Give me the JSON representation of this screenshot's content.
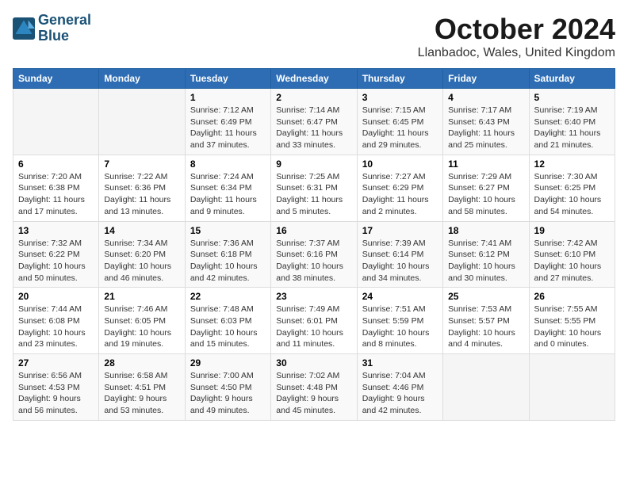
{
  "header": {
    "logo_line1": "General",
    "logo_line2": "Blue",
    "title": "October 2024",
    "location": "Llanbadoc, Wales, United Kingdom"
  },
  "weekdays": [
    "Sunday",
    "Monday",
    "Tuesday",
    "Wednesday",
    "Thursday",
    "Friday",
    "Saturday"
  ],
  "weeks": [
    [
      {
        "day": "",
        "info": ""
      },
      {
        "day": "",
        "info": ""
      },
      {
        "day": "1",
        "info": "Sunrise: 7:12 AM\nSunset: 6:49 PM\nDaylight: 11 hours and 37 minutes."
      },
      {
        "day": "2",
        "info": "Sunrise: 7:14 AM\nSunset: 6:47 PM\nDaylight: 11 hours and 33 minutes."
      },
      {
        "day": "3",
        "info": "Sunrise: 7:15 AM\nSunset: 6:45 PM\nDaylight: 11 hours and 29 minutes."
      },
      {
        "day": "4",
        "info": "Sunrise: 7:17 AM\nSunset: 6:43 PM\nDaylight: 11 hours and 25 minutes."
      },
      {
        "day": "5",
        "info": "Sunrise: 7:19 AM\nSunset: 6:40 PM\nDaylight: 11 hours and 21 minutes."
      }
    ],
    [
      {
        "day": "6",
        "info": "Sunrise: 7:20 AM\nSunset: 6:38 PM\nDaylight: 11 hours and 17 minutes."
      },
      {
        "day": "7",
        "info": "Sunrise: 7:22 AM\nSunset: 6:36 PM\nDaylight: 11 hours and 13 minutes."
      },
      {
        "day": "8",
        "info": "Sunrise: 7:24 AM\nSunset: 6:34 PM\nDaylight: 11 hours and 9 minutes."
      },
      {
        "day": "9",
        "info": "Sunrise: 7:25 AM\nSunset: 6:31 PM\nDaylight: 11 hours and 5 minutes."
      },
      {
        "day": "10",
        "info": "Sunrise: 7:27 AM\nSunset: 6:29 PM\nDaylight: 11 hours and 2 minutes."
      },
      {
        "day": "11",
        "info": "Sunrise: 7:29 AM\nSunset: 6:27 PM\nDaylight: 10 hours and 58 minutes."
      },
      {
        "day": "12",
        "info": "Sunrise: 7:30 AM\nSunset: 6:25 PM\nDaylight: 10 hours and 54 minutes."
      }
    ],
    [
      {
        "day": "13",
        "info": "Sunrise: 7:32 AM\nSunset: 6:22 PM\nDaylight: 10 hours and 50 minutes."
      },
      {
        "day": "14",
        "info": "Sunrise: 7:34 AM\nSunset: 6:20 PM\nDaylight: 10 hours and 46 minutes."
      },
      {
        "day": "15",
        "info": "Sunrise: 7:36 AM\nSunset: 6:18 PM\nDaylight: 10 hours and 42 minutes."
      },
      {
        "day": "16",
        "info": "Sunrise: 7:37 AM\nSunset: 6:16 PM\nDaylight: 10 hours and 38 minutes."
      },
      {
        "day": "17",
        "info": "Sunrise: 7:39 AM\nSunset: 6:14 PM\nDaylight: 10 hours and 34 minutes."
      },
      {
        "day": "18",
        "info": "Sunrise: 7:41 AM\nSunset: 6:12 PM\nDaylight: 10 hours and 30 minutes."
      },
      {
        "day": "19",
        "info": "Sunrise: 7:42 AM\nSunset: 6:10 PM\nDaylight: 10 hours and 27 minutes."
      }
    ],
    [
      {
        "day": "20",
        "info": "Sunrise: 7:44 AM\nSunset: 6:08 PM\nDaylight: 10 hours and 23 minutes."
      },
      {
        "day": "21",
        "info": "Sunrise: 7:46 AM\nSunset: 6:05 PM\nDaylight: 10 hours and 19 minutes."
      },
      {
        "day": "22",
        "info": "Sunrise: 7:48 AM\nSunset: 6:03 PM\nDaylight: 10 hours and 15 minutes."
      },
      {
        "day": "23",
        "info": "Sunrise: 7:49 AM\nSunset: 6:01 PM\nDaylight: 10 hours and 11 minutes."
      },
      {
        "day": "24",
        "info": "Sunrise: 7:51 AM\nSunset: 5:59 PM\nDaylight: 10 hours and 8 minutes."
      },
      {
        "day": "25",
        "info": "Sunrise: 7:53 AM\nSunset: 5:57 PM\nDaylight: 10 hours and 4 minutes."
      },
      {
        "day": "26",
        "info": "Sunrise: 7:55 AM\nSunset: 5:55 PM\nDaylight: 10 hours and 0 minutes."
      }
    ],
    [
      {
        "day": "27",
        "info": "Sunrise: 6:56 AM\nSunset: 4:53 PM\nDaylight: 9 hours and 56 minutes."
      },
      {
        "day": "28",
        "info": "Sunrise: 6:58 AM\nSunset: 4:51 PM\nDaylight: 9 hours and 53 minutes."
      },
      {
        "day": "29",
        "info": "Sunrise: 7:00 AM\nSunset: 4:50 PM\nDaylight: 9 hours and 49 minutes."
      },
      {
        "day": "30",
        "info": "Sunrise: 7:02 AM\nSunset: 4:48 PM\nDaylight: 9 hours and 45 minutes."
      },
      {
        "day": "31",
        "info": "Sunrise: 7:04 AM\nSunset: 4:46 PM\nDaylight: 9 hours and 42 minutes."
      },
      {
        "day": "",
        "info": ""
      },
      {
        "day": "",
        "info": ""
      }
    ]
  ]
}
